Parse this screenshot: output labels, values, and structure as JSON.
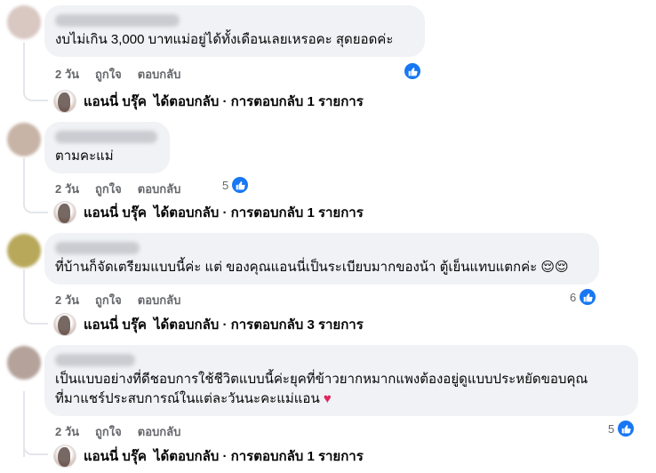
{
  "comments": [
    {
      "text": "งบไม่เกิน 3,000 บาทแม่อยู่ได้ทั้งเดือนเลยเหรอคะ สุดยอดค่ะ",
      "time": "2 วัน",
      "like_label": "ถูกใจ",
      "reply_label": "ตอบกลับ",
      "reaction_count": "",
      "reply_summary_author": "แอนนี่ บรุ๊ค",
      "reply_summary_text": "ได้ตอบกลับ · การตอบกลับ 1 รายการ",
      "avatar_color": "#d9c7c2"
    },
    {
      "text": "ตามคะแม่",
      "time": "2 วัน",
      "like_label": "ถูกใจ",
      "reply_label": "ตอบกลับ",
      "reaction_count": "5",
      "reply_summary_author": "แอนนี่ บรุ๊ค",
      "reply_summary_text": "ได้ตอบกลับ · การตอบกลับ 1 รายการ",
      "avatar_color": "#c8b4a6"
    },
    {
      "text": "ที่บ้านก็จัดเตรียมแบบนี้ค่ะ แต่ ของคุณแอนนี่เป็นระเบียบมากของน้า ตู้เย็นแทบแตกค่ะ",
      "emoji": "😌😌",
      "time": "2 วัน",
      "like_label": "ถูกใจ",
      "reply_label": "ตอบกลับ",
      "reaction_count": "6",
      "reply_summary_author": "แอนนี่ บรุ๊ค",
      "reply_summary_text": "ได้ตอบกลับ · การตอบกลับ 3 รายการ",
      "avatar_color": "#b8a85a"
    },
    {
      "text_line1": "เป็นแบบอย่างที่ดีชอบการใช้ชีวิตแบบนี้ค่ะยุคที่ข้าวยากหมากแพงต้องอยู่ดูแบบประหยัดขอบคุณ",
      "text_line2": "ที่มาแชร์ประสบการณ์ในแต่ละวันนะคะแม่แอน",
      "heart": "♥",
      "time": "2 วัน",
      "like_label": "ถูกใจ",
      "reply_label": "ตอบกลับ",
      "reaction_count": "5",
      "reply_summary_author": "แอนนี่ บรุ๊ค",
      "reply_summary_text": "ได้ตอบกลับ · การตอบกลับ 1 รายการ",
      "avatar_color": "#b5a39b"
    }
  ],
  "colors": {
    "bubble": "#f0f2f5",
    "like_blue": "#1877f2",
    "meta_text": "#65676b",
    "heart": "#e0245e"
  }
}
